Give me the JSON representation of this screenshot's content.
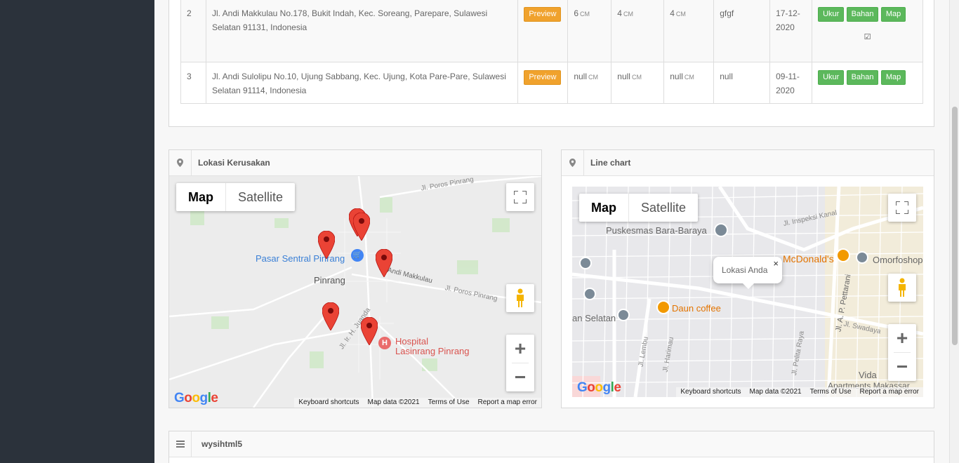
{
  "table": {
    "rows": [
      {
        "no": "2",
        "address": "Jl. Andi Makkulau No.178, Bukit Indah, Kec. Soreang, Parepare, Sulawesi Selatan 91131, Indonesia",
        "preview": "Preview",
        "p": "6",
        "l": "4",
        "t": "4",
        "unit": "CM",
        "material": "gfgf",
        "date": "17-12-2020",
        "ukur": "Ukur",
        "bahan": "Bahan",
        "map": "Map",
        "check": "☑"
      },
      {
        "no": "3",
        "address": "Jl. Andi Sulolipu No.10, Ujung Sabbang, Kec. Ujung, Kota Pare-Pare, Sulawesi Selatan 91114, Indonesia",
        "preview": "Preview",
        "p": "null",
        "l": "null",
        "t": "null",
        "unit": "CM",
        "material": "null",
        "date": "09-11-2020",
        "ukur": "Ukur",
        "bahan": "Bahan",
        "map": "Map"
      }
    ]
  },
  "panel_left": {
    "title": "Lokasi Kerusakan",
    "icon": "map-marker-icon",
    "map": {
      "type_map": "Map",
      "type_satellite": "Satellite",
      "labels": {
        "city": "Pinrang",
        "pasar": "Pasar Sentral Pinrang",
        "hospital_1": "Hospital",
        "hospital_2": "Lasinrang Pinrang",
        "road_1": "Jl. Poros Pinrang",
        "road_2": "Jl. Andi Makkulau",
        "road_3": "Jl. Poros Pinrang",
        "road_4": "Jl. Ir. H. Juanda"
      },
      "attribution": [
        "Keyboard shortcuts",
        "Map data ©2021",
        "Terms of Use",
        "Report a map error"
      ],
      "logo": "Google"
    }
  },
  "panel_right": {
    "title": "Line chart",
    "icon": "map-marker-icon",
    "map": {
      "type_map": "Map",
      "type_satellite": "Satellite",
      "labels": {
        "puskesmas": "Puskesmas Bara-Baraya",
        "mcd": "McDonald's",
        "omoro": "Omorfoshop",
        "daun": "Daun coffee",
        "selatan": "an Selatan",
        "apartments": "Apartments Makassar",
        "vida": "Vida",
        "pettarani": "Jl. A. P. Pettarani",
        "road_a": "Jl. Inspeksi Kanal",
        "road_b": "Jl. Pelita Raya",
        "road_c": "Jl. Swadaya",
        "road_d": "Jl. Lembu",
        "road_e": "Jl. Harimau"
      },
      "infowindow": "Lokasi Anda",
      "attribution": [
        "Keyboard shortcuts",
        "Map data ©2021",
        "Terms of Use",
        "Report a map error"
      ],
      "logo": "Google"
    }
  },
  "panel_bottom": {
    "title": "wysihtml5",
    "icon": "list-icon"
  },
  "colors": {
    "sidebar": "#2b323b",
    "warning_button": "#f0a22d",
    "success_button": "#5cb85c",
    "pin": "#ea4335"
  }
}
